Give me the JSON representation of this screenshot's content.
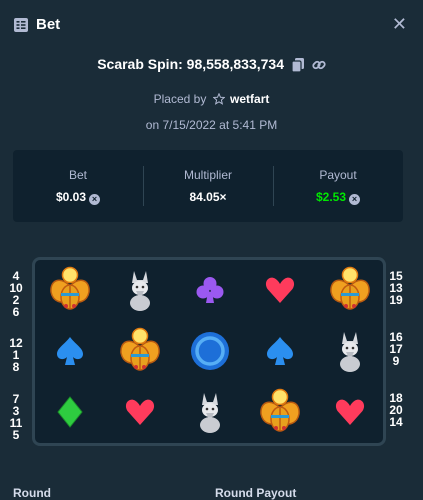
{
  "header": {
    "title": "Bet",
    "icon": "bet-list-icon",
    "close_icon": "close-icon",
    "close_glyph": "✕"
  },
  "spin": {
    "label": "Scarab Spin: 98,558,833,734"
  },
  "placed": {
    "prefix": "Placed by",
    "user": "wetfart"
  },
  "date": "on 7/15/2022 at 5:41 PM",
  "stats": [
    {
      "label": "Bet",
      "value": "$0.03"
    },
    {
      "label": "Multiplier",
      "value": "84.05×"
    },
    {
      "label": "Payout",
      "value": "$2.53"
    }
  ],
  "stat_colors": {
    "payout": "#00e701"
  },
  "xmark": "×",
  "side_left": [
    [
      "4",
      "10",
      "2",
      "6"
    ],
    [
      "12",
      "1",
      "8"
    ],
    [
      "7",
      "3",
      "11",
      "5"
    ]
  ],
  "side_right": [
    [
      "15",
      "13",
      "19"
    ],
    [
      "16",
      "17",
      "9"
    ],
    [
      "18",
      "20",
      "14"
    ]
  ],
  "reels": [
    [
      "scarab",
      "wolf",
      "club",
      "heart",
      "scarab"
    ],
    [
      "spade",
      "scarab",
      "coin",
      "spade",
      "wolf"
    ],
    [
      "diamond",
      "heart",
      "wolf",
      "scarab",
      "heart"
    ]
  ],
  "footer": {
    "left": "Round",
    "center": "Round Payout"
  }
}
